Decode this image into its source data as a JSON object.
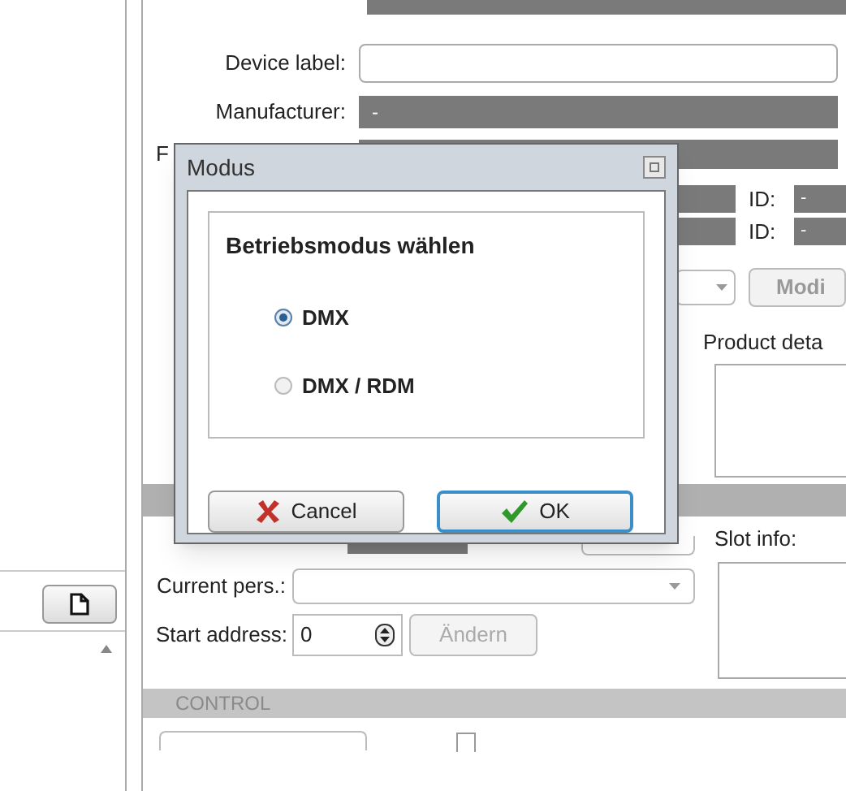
{
  "form": {
    "device_label": {
      "label": "Device label:"
    },
    "manufacturer": {
      "label": "Manufacturer:",
      "value": "-"
    },
    "row_4_label": "F",
    "id_fields": [
      {
        "label": "ID:",
        "value": "-"
      },
      {
        "label": "ID:",
        "value": "-"
      }
    ],
    "modify_button": "Modi",
    "product_details_label": "Product deta",
    "slot_info_label": "Slot info:",
    "current_pers": {
      "label": "Current pers.:"
    },
    "start_address": {
      "label": "Start address:",
      "value": "0"
    },
    "change_button": {
      "label": "Ändern",
      "disabled": true
    },
    "control_section": "CONTROL",
    "control_checkbox": {
      "checked": false
    }
  },
  "dialog": {
    "title": "Modus",
    "group_title": "Betriebsmodus wählen",
    "options": [
      {
        "label": "DMX",
        "selected": true
      },
      {
        "label": "DMX / RDM",
        "selected": false
      }
    ],
    "buttons": [
      {
        "kind": "cancel",
        "label": "Cancel"
      },
      {
        "kind": "ok",
        "label": "OK"
      }
    ]
  }
}
